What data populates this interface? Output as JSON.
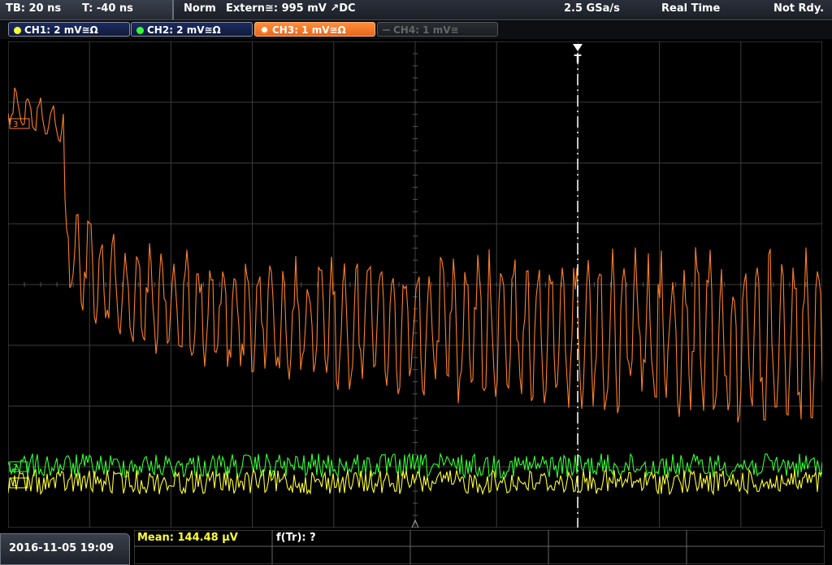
{
  "status": {
    "timebase": "TB: 20 ns",
    "trigger_offset": "T: -40 ns",
    "mode": "Norm",
    "trigger_source": "Extern≅: 995 mV ↗DC",
    "sample_rate": "2.5 GSa/s",
    "acquisition": "Real Time",
    "ready_state": "Not Rdy."
  },
  "channels": [
    {
      "label": "CH1: 2 mV≅Ω",
      "color": "#ffff33",
      "active": true
    },
    {
      "label": "CH2: 2 mV≅Ω",
      "color": "#33ff33",
      "active": true
    },
    {
      "label": "CH3: 1 mV≅Ω",
      "color": "#ff7f27",
      "active": true,
      "selected": true
    },
    {
      "label": "CH4: 1 mV≅",
      "color": "#666666",
      "active": false
    }
  ],
  "markers": {
    "trigger": "T",
    "ch3_ref": "3",
    "ch2_ref": "2",
    "ch1_ref": "1"
  },
  "bottom": {
    "datetime": "2016-11-05 19:09",
    "measure1": "Mean: 144.48 µV",
    "measure2": "f(Tr): ?"
  },
  "colors": {
    "grid": "#3c3c3c",
    "ch1": "#ffff33",
    "ch2": "#33ff33",
    "ch3": "#ff7f27",
    "measure_label": "#ffff33"
  }
}
